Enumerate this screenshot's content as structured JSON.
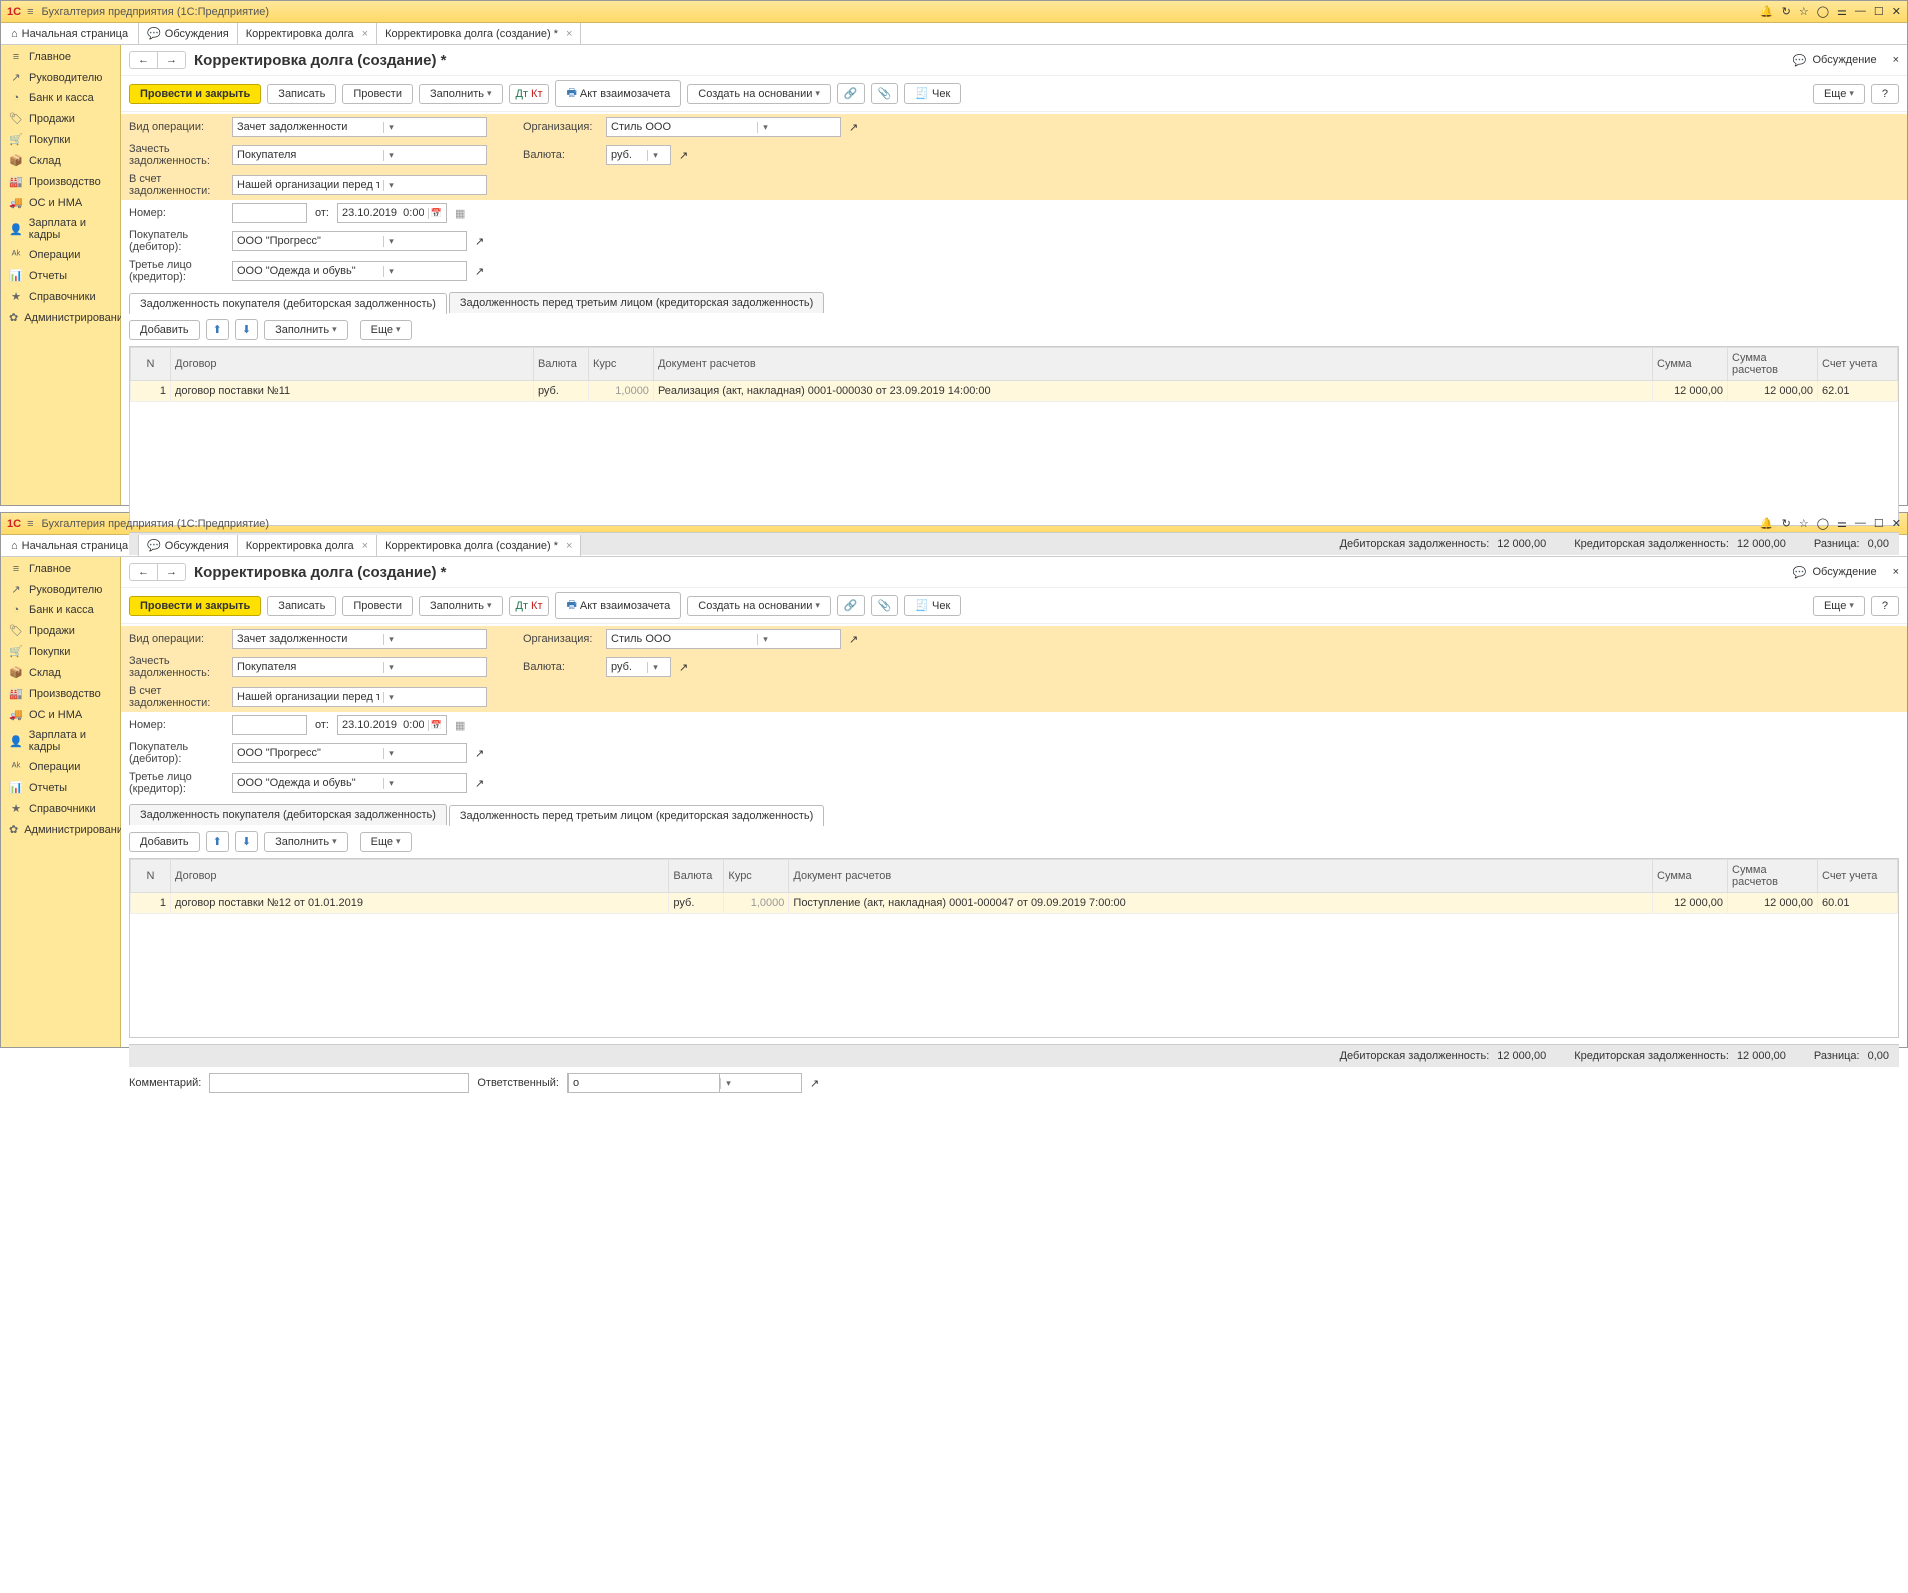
{
  "app_title": "Бухгалтерия предприятия  (1С:Предприятие)",
  "home_tab": "Начальная страница",
  "tabs": [
    "Обсуждения",
    "Корректировка долга",
    "Корректировка долга (создание) *"
  ],
  "sidebar": [
    "Главное",
    "Руководителю",
    "Банк и касса",
    "Продажи",
    "Покупки",
    "Склад",
    "Производство",
    "ОС и НМА",
    "Зарплата и кадры",
    "Операции",
    "Отчеты",
    "Справочники",
    "Администрирование"
  ],
  "sidebar_icons": [
    "≡",
    "↗",
    "◔",
    "🏷",
    "🛒",
    "📦",
    "🏭",
    "🚚",
    "👤",
    "ᴬᵏ",
    "📊",
    "★",
    "✿"
  ],
  "page_title": "Корректировка долга (создание) *",
  "discussion": "Обсуждение",
  "cmd": {
    "post_close": "Провести и закрыть",
    "save": "Записать",
    "post": "Провести",
    "fill": "Заполнить",
    "act": "Акт взаимозачета",
    "create_on": "Создать на основании",
    "cheque": "Чек",
    "more": "Еще",
    "help": "?"
  },
  "labels": {
    "oper_type": "Вид операции:",
    "offset": "Зачесть задолженность:",
    "against": "В счет задолженности:",
    "number": "Номер:",
    "from": "от:",
    "buyer": "Покупатель (дебитор):",
    "third": "Третье лицо (кредитор):",
    "org": "Организация:",
    "currency": "Валюта:"
  },
  "values": {
    "oper_type": "Зачет задолженности",
    "offset": "Покупателя",
    "against": "Нашей организации перед третьим лицом",
    "date": "23.10.2019  0:00:00",
    "buyer": "ООО \"Прогресс\"",
    "third": "ООО \"Одежда и обувь\"",
    "org": "Стиль ООО",
    "currency": "руб."
  },
  "doc_tabs": [
    "Задолженность покупателя (дебиторская задолженность)",
    "Задолженность перед третьим лицом (кредиторская задолженность)"
  ],
  "tblbar": {
    "add": "Добавить",
    "fill": "Заполнить",
    "more": "Еще"
  },
  "columns": [
    "N",
    "Договор",
    "Валюта",
    "Курс",
    "Документ расчетов",
    "Сумма",
    "Сумма расчетов",
    "Счет учета"
  ],
  "row1": {
    "n": "1",
    "contract": "договор поставки №11",
    "cur": "руб.",
    "rate": "1,0000",
    "doc": "Реализация (акт, накладная) 0001-000030 от 23.09.2019 14:00:00",
    "sum": "12 000,00",
    "sum2": "12 000,00",
    "acc": "62.01"
  },
  "row2": {
    "n": "1",
    "contract": "договор поставки №12 от 01.01.2019",
    "cur": "руб.",
    "rate": "1,0000",
    "doc": "Поступление (акт, накладная) 0001-000047 от 09.09.2019 7:00:00",
    "sum": "12 000,00",
    "sum2": "12 000,00",
    "acc": "60.01"
  },
  "footer": {
    "deb_l": "Дебиторская задолженность:",
    "deb_v": "12 000,00",
    "cred_l": "Кредиторская задолженность:",
    "cred_v": "12 000,00",
    "diff_l": "Разница:",
    "diff_v": "0,00"
  },
  "comment": {
    "label": "Комментарий:",
    "resp_label": "Ответственный:",
    "resp_val": "о"
  }
}
